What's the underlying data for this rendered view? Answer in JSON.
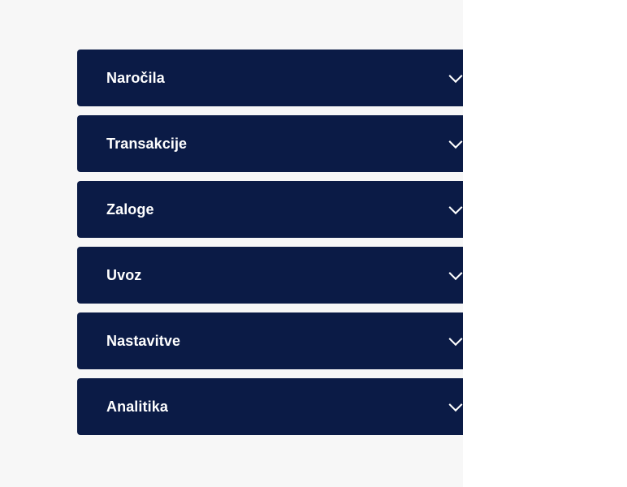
{
  "menu": {
    "items": [
      {
        "label": "Naročila",
        "icon": "chevron-down-icon"
      },
      {
        "label": "Transakcije",
        "icon": "chevron-down-icon"
      },
      {
        "label": "Zaloge",
        "icon": "chevron-down-icon"
      },
      {
        "label": "Uvoz",
        "icon": "chevron-down-icon"
      },
      {
        "label": "Nastavitve",
        "icon": "chevron-down-icon"
      },
      {
        "label": "Analitika",
        "icon": "chevron-down-icon"
      }
    ]
  },
  "colors": {
    "item_background": "#0b1b46",
    "page_background": "#f7f7f7",
    "label": "#ffffff"
  }
}
